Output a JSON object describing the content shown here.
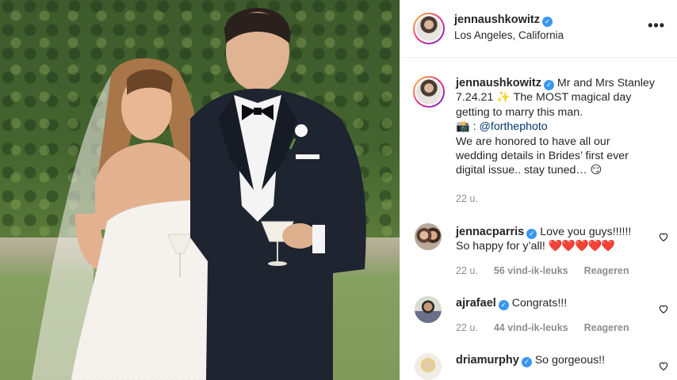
{
  "post": {
    "username": "jennaushkowitz",
    "location": "Los Angeles, California",
    "caption_lines": [
      "Mr and Mrs Stanley",
      "7.24.21 ✨ The MOST magical day",
      "getting to marry this man.",
      "📸 :",
      "@forthephoto",
      "We are honored to have all our",
      "wedding details in Brides’ first ever",
      "digital issue.. stay tuned… 😏"
    ],
    "time": "22 u."
  },
  "comments": [
    {
      "username": "jennacparris",
      "text": "Love you guys!!!!!!",
      "text2": "So happy for y’all!",
      "hearts": "❤️❤️❤️❤️❤️",
      "time": "22 u.",
      "likes": "56 vind-ik-leuks",
      "reply": "Reageren"
    },
    {
      "username": "ajrafael",
      "text": "Congrats!!!",
      "time": "22 u.",
      "likes": "44 vind-ik-leuks",
      "reply": "Reageren"
    },
    {
      "username": "driamurphy",
      "text": "So gorgeous!!"
    }
  ],
  "colors": {
    "verified": "#3897f0",
    "link": "#00376b",
    "muted": "#8e8e8e"
  },
  "icons": [
    "verified-badge-icon",
    "more-options-icon",
    "heart-icon"
  ]
}
